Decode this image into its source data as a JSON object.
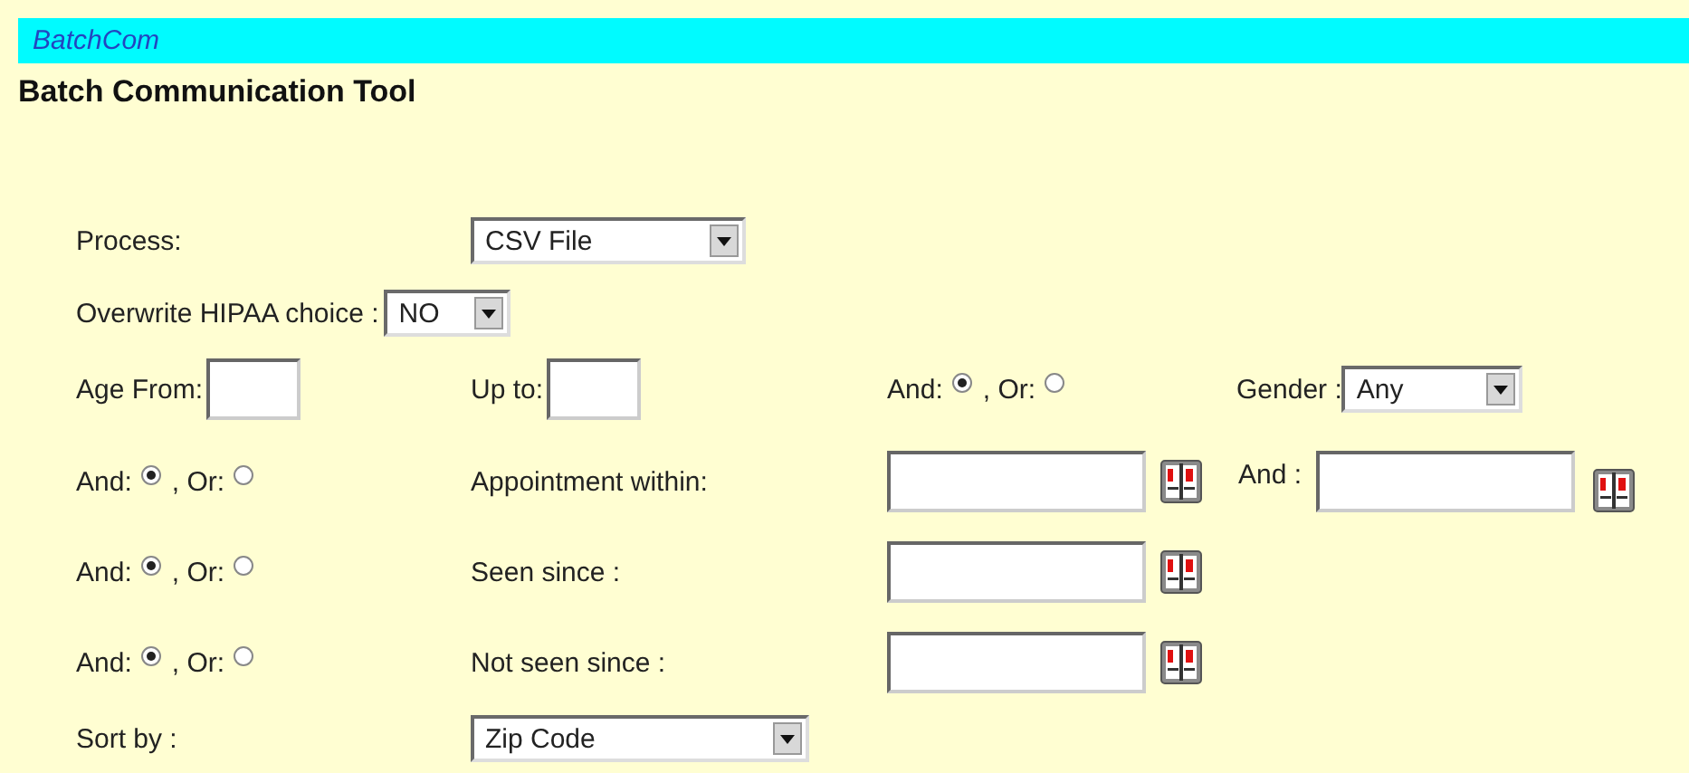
{
  "header": {
    "app_name": "BatchCom"
  },
  "title": "Batch Communication Tool",
  "process": {
    "label": "Process:",
    "value": "CSV File"
  },
  "overwrite_hipaa": {
    "label": "Overwrite HIPAA choice :",
    "value": "NO"
  },
  "age": {
    "from_label": "Age From:",
    "to_label": "Up to:",
    "logic": [
      {
        "label": "And:",
        "selected": true
      },
      {
        "label": ", Or:",
        "selected": false
      }
    ]
  },
  "gender": {
    "label": "Gender :",
    "value": "Any"
  },
  "criteria": [
    {
      "kind": "range",
      "logic": [
        {
          "label": "And:",
          "selected": true
        },
        {
          "label": ", Or:",
          "selected": false
        }
      ],
      "label": "Appointment within:",
      "range_label": "And :"
    },
    {
      "kind": "date",
      "logic": [
        {
          "label": "And:",
          "selected": true
        },
        {
          "label": ", Or:",
          "selected": false
        }
      ],
      "label": "Seen since :"
    },
    {
      "kind": "date",
      "logic": [
        {
          "label": "And:",
          "selected": true
        },
        {
          "label": ", Or:",
          "selected": false
        }
      ],
      "label": "Not seen since :"
    }
  ],
  "sort": {
    "label": "Sort by :",
    "value": "Zip Code"
  }
}
